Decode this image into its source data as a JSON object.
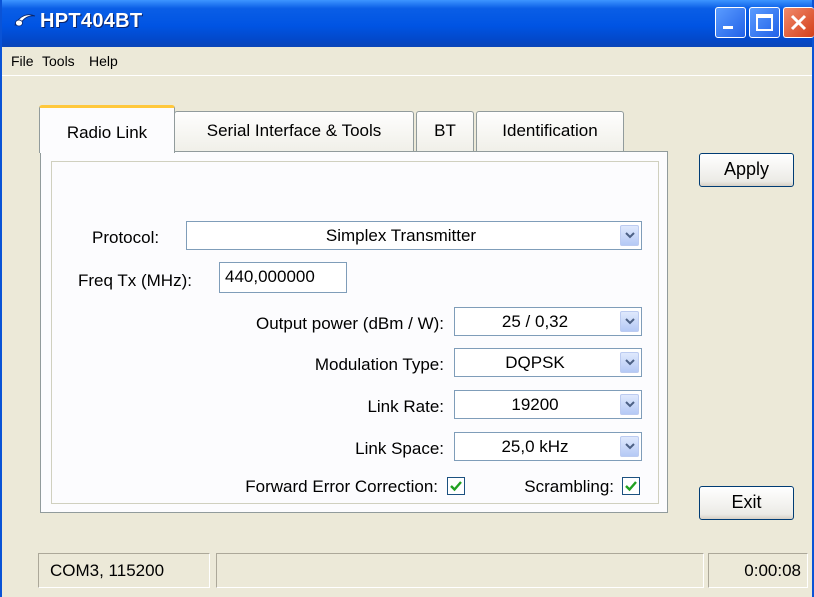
{
  "window": {
    "title": "HPT404BT",
    "icon": "swoosh-icon",
    "title_color": "#0054e3"
  },
  "menu": {
    "file": "File",
    "tools": "Tools",
    "help": "Help"
  },
  "tabs": [
    {
      "label": "Radio Link",
      "active": true
    },
    {
      "label": "Serial Interface & Tools",
      "active": false
    },
    {
      "label": "BT",
      "active": false
    },
    {
      "label": "Identification",
      "active": false
    }
  ],
  "form": {
    "protocol_label": "Protocol:",
    "protocol_value": "Simplex Transmitter",
    "freq_label": "Freq Tx (MHz):",
    "freq_value": "440,000000",
    "power_label": "Output power (dBm / W):",
    "power_value": "25 / 0,32",
    "modulation_label": "Modulation Type:",
    "modulation_value": "DQPSK",
    "link_rate_label": "Link Rate:",
    "link_rate_value": "19200",
    "link_space_label": "Link Space:",
    "link_space_value": "25,0 kHz",
    "fec_label": "Forward Error Correction:",
    "fec_checked": true,
    "scrambling_label": "Scrambling:",
    "scrambling_checked": true
  },
  "buttons": {
    "apply": "Apply",
    "exit": "Exit"
  },
  "status": {
    "port": "COM3, 115200",
    "middle": "",
    "elapsed": "0:00:08"
  }
}
